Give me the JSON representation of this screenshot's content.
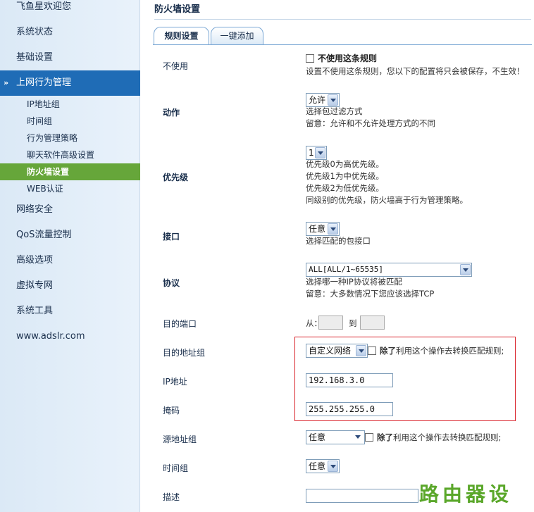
{
  "sidebar": {
    "top_item": "飞鱼星欢迎您",
    "items": [
      "系统状态",
      "基础设置"
    ],
    "active_group": "上网行为管理",
    "subitems": [
      "IP地址组",
      "时间组",
      "行为管理策略",
      "聊天软件高级设置",
      "防火墙设置",
      "WEB认证"
    ],
    "lower_items": [
      "网络安全",
      "QoS流量控制",
      "高级选项",
      "虚拟专网",
      "系统工具",
      "www.adslr.com"
    ]
  },
  "page": {
    "title": "防火墙设置",
    "tabs": [
      "规则设置",
      "一键添加"
    ]
  },
  "form": {
    "disable": {
      "label": "不使用",
      "checkbox_label": "不使用这条规则",
      "desc": "设置不使用这条规则，您以下的配置将只会被保存，不生效！"
    },
    "action": {
      "label": "动作",
      "value": "允许",
      "desc1": "选择包过滤方式",
      "desc2": "留意：允许和不允许处理方式的不同"
    },
    "priority": {
      "label": "优先级",
      "value": "1",
      "desc1": "优先级0为高优先级。",
      "desc2": "优先级1为中优先级。",
      "desc3": "优先级2为低优先级。",
      "desc4": "同级别的优先级，防火墙高于行为管理策略。"
    },
    "interface": {
      "label": "接口",
      "value": "任意",
      "desc": "选择匹配的包接口"
    },
    "protocol": {
      "label": "协议",
      "value": "ALL[ALL/1~65535]",
      "desc1": "选择哪一种IP协议将被匹配",
      "desc2": "留意：大多数情况下您应该选择TCP"
    },
    "dest_port": {
      "label": "目的端口",
      "from": "从：",
      "to": "到"
    },
    "dest_group": {
      "label": "目的地址组",
      "value": "自定义网络",
      "except_bold": "除了",
      "except_rest": "利用这个操作去转换匹配规则;"
    },
    "ip": {
      "label": "IP地址",
      "value": "192.168.3.0"
    },
    "mask": {
      "label": "掩码",
      "value": "255.255.255.0"
    },
    "src_group": {
      "label": "源地址组",
      "value": "任意",
      "except_bold": "除了",
      "except_rest": "利用这个操作去转换匹配规则;"
    },
    "time_group": {
      "label": "时间组",
      "value": "任意"
    },
    "description": {
      "label": "描述",
      "value": ""
    }
  },
  "watermark": "路由器设置",
  "colors": {
    "sidebar_active": "#1f6cb6",
    "sub_active": "#66a63a",
    "highlight_border": "#d9232b",
    "watermark": "#5aa72a"
  }
}
